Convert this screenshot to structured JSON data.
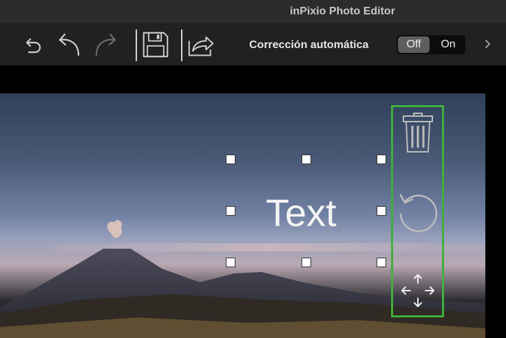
{
  "window": {
    "title": "inPixio Photo Editor"
  },
  "toolbar": {
    "auto_correction_label": "Corrección automática",
    "toggle": {
      "off_label": "Off",
      "on_label": "On",
      "selected": "Off"
    }
  },
  "text_layer": {
    "text": "Text"
  },
  "icons": {
    "history": "undo-all-icon",
    "undo": "undo-icon",
    "redo": "redo-icon",
    "save": "save-icon",
    "share": "share-icon",
    "more": "chevron-right-icon",
    "delete": "trash-icon",
    "rotate": "rotate-icon",
    "move": "move-arrows-icon"
  },
  "colors": {
    "highlight": "#3fb03c",
    "toolbar": "#212121",
    "titlebar": "#2b2b2b"
  }
}
